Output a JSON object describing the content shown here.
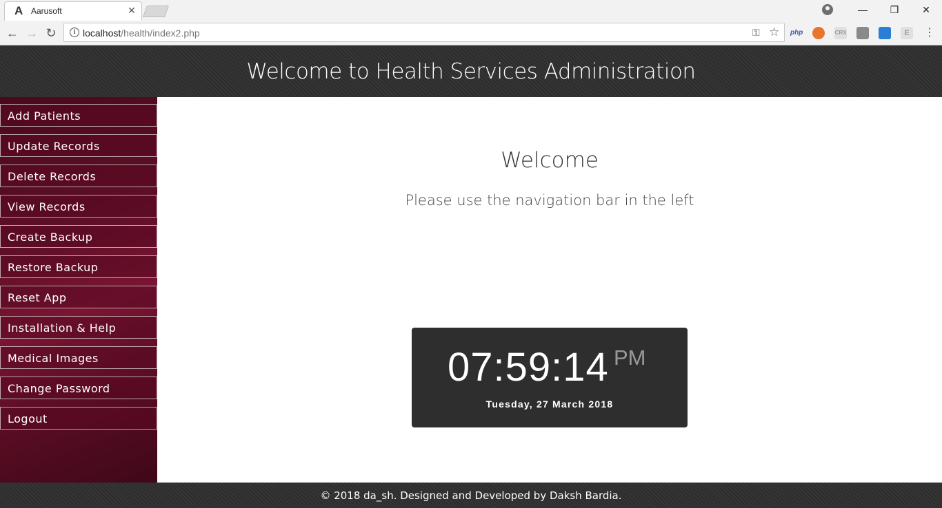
{
  "browser": {
    "tab_title": "Aarusoft",
    "tab_logo": "A",
    "close_tab_glyph": "✕",
    "url_host": "localhost",
    "url_path": "/health/index2.php",
    "window_controls": {
      "minimize": "—",
      "restore": "❐",
      "close": "✕"
    },
    "extensions": [
      {
        "name": "php-extension-icon",
        "label": "php",
        "color": "#3b5bb5"
      },
      {
        "name": "orange-extension-icon",
        "label": "",
        "color": "#e8752d"
      },
      {
        "name": "crx-extension-icon",
        "label": "CRX",
        "color": "#999999"
      },
      {
        "name": "cube-extension-icon",
        "label": "",
        "color": "#8a8a8a"
      },
      {
        "name": "note-extension-icon",
        "label": "",
        "color": "#2a7fd4"
      },
      {
        "name": "e-extension-icon",
        "label": "E",
        "color": "#a0a0a0"
      }
    ]
  },
  "header": {
    "title": "Welcome to Health Services Administration"
  },
  "sidebar": {
    "items": [
      {
        "label": "Add Patients"
      },
      {
        "label": "Update Records"
      },
      {
        "label": "Delete Records"
      },
      {
        "label": "View Records"
      },
      {
        "label": "Create Backup"
      },
      {
        "label": "Restore Backup"
      },
      {
        "label": "Reset App"
      },
      {
        "label": "Installation & Help"
      },
      {
        "label": "Medical Images"
      },
      {
        "label": "Change Password"
      },
      {
        "label": "Logout"
      }
    ]
  },
  "main": {
    "heading": "Welcome",
    "subheading": "Please use the navigation bar in the left",
    "clock": {
      "time": "07:59:14",
      "ampm": "PM",
      "date": "Tuesday, 27 March 2018"
    }
  },
  "footer": {
    "text": "© 2018 da_sh. Designed and Developed by Daksh Bardia."
  },
  "colors": {
    "header_bg": "#2f2f2f",
    "sidebar_bg": "#5e0f26",
    "clock_bg": "#2e2e2e"
  }
}
